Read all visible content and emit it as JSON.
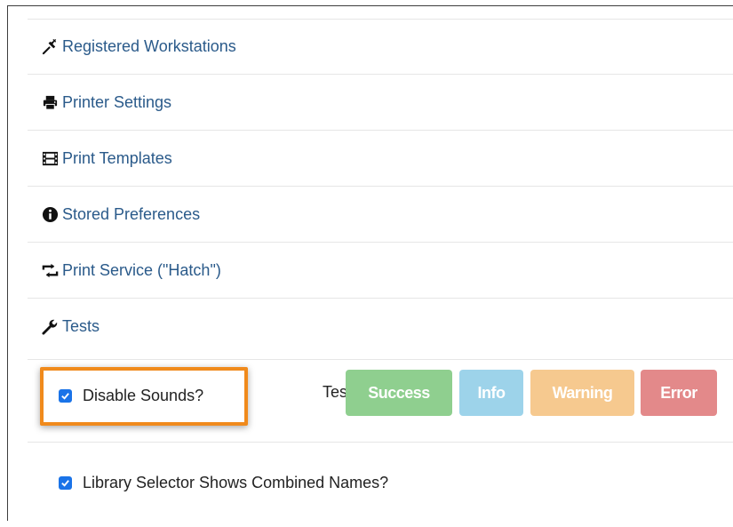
{
  "menu": {
    "items": [
      {
        "label": "Registered Workstations",
        "icon": "pushpin-icon"
      },
      {
        "label": "Printer Settings",
        "icon": "printer-icon"
      },
      {
        "label": "Print Templates",
        "icon": "film-icon"
      },
      {
        "label": "Stored Preferences",
        "icon": "info-sign-icon"
      },
      {
        "label": "Print Service (\"Hatch\")",
        "icon": "retweet-icon"
      },
      {
        "label": "Tests",
        "icon": "wrench-icon"
      }
    ]
  },
  "sounds": {
    "disable_label": "Disable Sounds?",
    "disable_checked": true,
    "test_label": "Test:",
    "buttons": {
      "success": "Success",
      "info": "Info",
      "warning": "Warning",
      "error": "Error"
    }
  },
  "library": {
    "combined_names_label": "Library Selector Shows Combined Names?",
    "combined_names_checked": true
  },
  "colors": {
    "link": "#2a5a8a",
    "highlight": "#f08a1c",
    "success": "#8fcf8f",
    "info": "#9dd3ea",
    "warning": "#f6c98f",
    "error": "#e3898a",
    "checkbox": "#1a73e8"
  }
}
